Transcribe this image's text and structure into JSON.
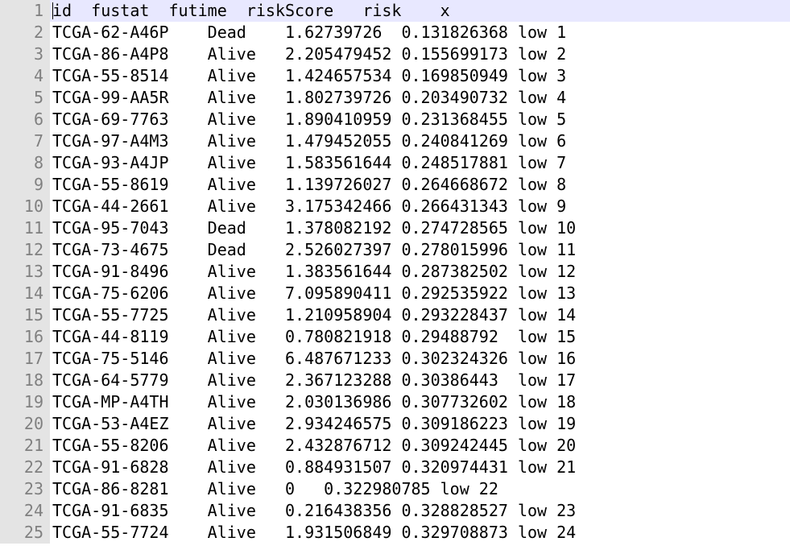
{
  "colors": {
    "gutter_bg": "#e4e4e4",
    "gutter_text": "#808080",
    "current_line_bg": "#e8e8ff",
    "text": "#000000"
  },
  "editor": {
    "current_line": 1,
    "lines": [
      {
        "num": "1",
        "text": "id  fustat  futime  riskScore   risk    x"
      },
      {
        "num": "2",
        "text": "TCGA-62-A46P    Dead    1.62739726  0.131826368 low 1"
      },
      {
        "num": "3",
        "text": "TCGA-86-A4P8    Alive   2.205479452 0.155699173 low 2"
      },
      {
        "num": "4",
        "text": "TCGA-55-8514    Alive   1.424657534 0.169850949 low 3"
      },
      {
        "num": "5",
        "text": "TCGA-99-AA5R    Alive   1.802739726 0.203490732 low 4"
      },
      {
        "num": "6",
        "text": "TCGA-69-7763    Alive   1.890410959 0.231368455 low 5"
      },
      {
        "num": "7",
        "text": "TCGA-97-A4M3    Alive   1.479452055 0.240841269 low 6"
      },
      {
        "num": "8",
        "text": "TCGA-93-A4JP    Alive   1.583561644 0.248517881 low 7"
      },
      {
        "num": "9",
        "text": "TCGA-55-8619    Alive   1.139726027 0.264668672 low 8"
      },
      {
        "num": "10",
        "text": "TCGA-44-2661    Alive   3.175342466 0.266431343 low 9"
      },
      {
        "num": "11",
        "text": "TCGA-95-7043    Dead    1.378082192 0.274728565 low 10"
      },
      {
        "num": "12",
        "text": "TCGA-73-4675    Dead    2.526027397 0.278015996 low 11"
      },
      {
        "num": "13",
        "text": "TCGA-91-8496    Alive   1.383561644 0.287382502 low 12"
      },
      {
        "num": "14",
        "text": "TCGA-75-6206    Alive   7.095890411 0.292535922 low 13"
      },
      {
        "num": "15",
        "text": "TCGA-55-7725    Alive   1.210958904 0.293228437 low 14"
      },
      {
        "num": "16",
        "text": "TCGA-44-8119    Alive   0.780821918 0.29488792  low 15"
      },
      {
        "num": "17",
        "text": "TCGA-75-5146    Alive   6.487671233 0.302324326 low 16"
      },
      {
        "num": "18",
        "text": "TCGA-64-5779    Alive   2.367123288 0.30386443  low 17"
      },
      {
        "num": "19",
        "text": "TCGA-MP-A4TH    Alive   2.030136986 0.307732602 low 18"
      },
      {
        "num": "20",
        "text": "TCGA-53-A4EZ    Alive   2.934246575 0.309186223 low 19"
      },
      {
        "num": "21",
        "text": "TCGA-55-8206    Alive   2.432876712 0.309242445 low 20"
      },
      {
        "num": "22",
        "text": "TCGA-91-6828    Alive   0.884931507 0.320974431 low 21"
      },
      {
        "num": "23",
        "text": "TCGA-86-8281    Alive   0   0.322980785 low 22"
      },
      {
        "num": "24",
        "text": "TCGA-91-6835    Alive   0.216438356 0.328828527 low 23"
      },
      {
        "num": "25",
        "text": "TCGA-55-7724    Alive   1.931506849 0.329708873 low 24"
      }
    ]
  }
}
